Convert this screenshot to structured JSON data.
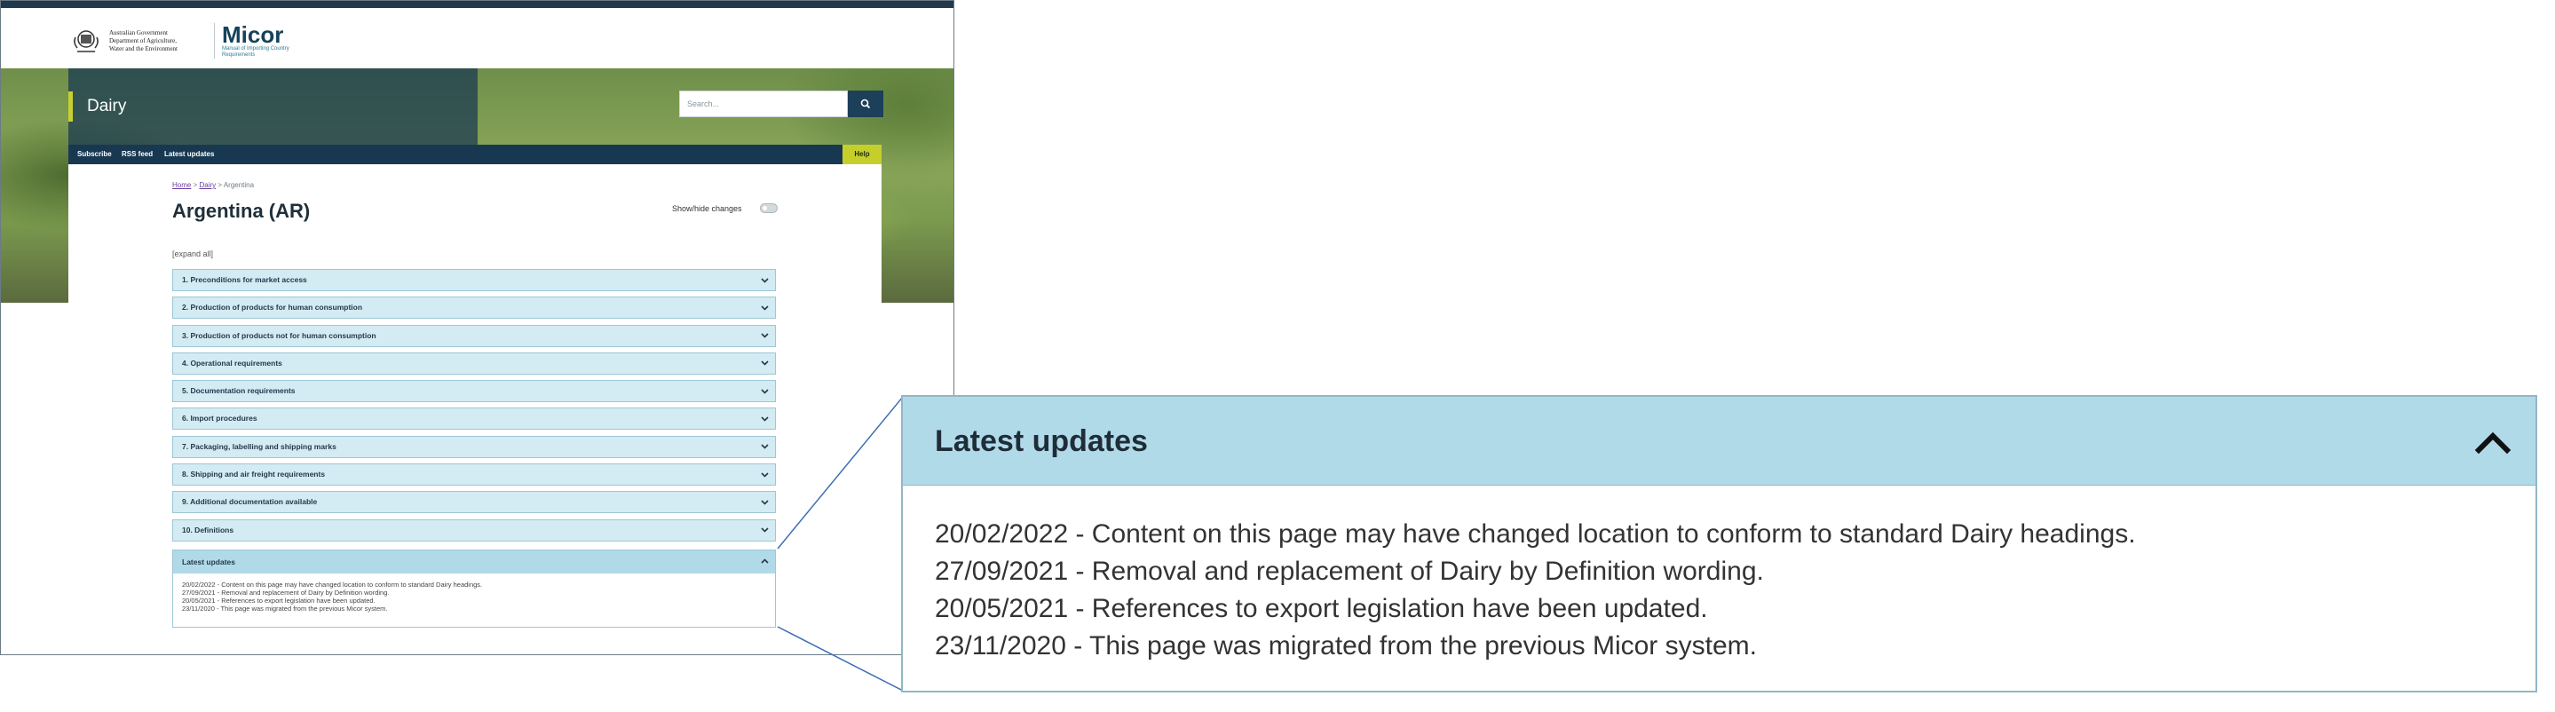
{
  "header": {
    "gov_text": [
      "Australian Government",
      "Department of Agriculture,",
      "Water and the Environment"
    ],
    "app_name": "Micor",
    "app_subtitle": "Manual of Importing Country Requirements"
  },
  "hero": {
    "section_title": "Dairy",
    "search_placeholder": "Search..."
  },
  "nav": {
    "items": [
      "Subscribe",
      "RSS feed",
      "Latest updates"
    ],
    "help_label": "Help"
  },
  "page": {
    "breadcrumb": [
      "Home",
      "Dairy",
      "Argentina"
    ],
    "title": "Argentina (AR)",
    "toggle_label": "Show/hide changes",
    "expand_all": "[expand all]"
  },
  "accordion": [
    "1. Preconditions for market access",
    "2. Production of products for human consumption",
    "3. Production of products not for human consumption",
    "4. Operational requirements",
    "5. Documentation requirements",
    "6. Import procedures",
    "7. Packaging, labelling and shipping marks",
    "8. Shipping and air freight requirements",
    "9. Additional documentation available",
    "10. Definitions"
  ],
  "latest_updates": {
    "title": "Latest updates",
    "entries": [
      "20/02/2022 - Content on this page may have changed location to conform to standard Dairy headings.",
      "27/09/2021 - Removal and replacement of Dairy by Definition wording.",
      "20/05/2021 - References to export legislation have been updated.",
      "23/11/2020 - This page was migrated from the previous Micor system."
    ]
  },
  "colors": {
    "accordion_bg": "#d3ebf3",
    "accordion_border": "#9ec6d6",
    "updates_header_bg": "#b1dae9",
    "nav_bg": "#183852",
    "help_bg": "#c6ce2c",
    "accent_link": "#6b3fa0"
  },
  "icons": [
    "crest-icon",
    "search-icon",
    "chevron-down-icon",
    "chevron-up-icon",
    "toggle-switch"
  ]
}
